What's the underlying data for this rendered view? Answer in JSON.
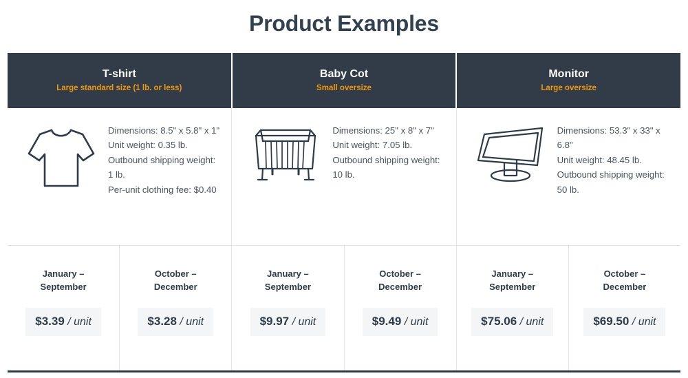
{
  "title": "Product Examples",
  "colors": {
    "header_bg": "#323c48",
    "header_accent": "#f0980c",
    "title_text": "#32414f",
    "body_text": "#4a5360",
    "price_pill_bg": "#f4f5f6",
    "border": "#e4e4e4",
    "bottom_rule": "#2e3b49"
  },
  "products": [
    {
      "name": "T-shirt",
      "size_class": "Large standard size (1 lb. or less)",
      "icon": "tshirt-icon",
      "specs": [
        "Dimensions: 8.5\" x 5.8\" x 1\"",
        "Unit weight: 0.35 lb.",
        "Outbound shipping weight: 1 lb.",
        "Per-unit clothing fee: $0.40"
      ],
      "pricing": [
        {
          "season": "January – September",
          "amount": "$3.39",
          "unit": "/ unit"
        },
        {
          "season": "October – December",
          "amount": "$3.28",
          "unit": "/ unit"
        }
      ]
    },
    {
      "name": "Baby Cot",
      "size_class": "Small oversize",
      "icon": "baby-cot-icon",
      "specs": [
        "Dimensions: 25\" x 8\" x 7\"",
        "Unit weight: 7.05 lb.",
        "Outbound shipping weight: 10 lb."
      ],
      "pricing": [
        {
          "season": "January – September",
          "amount": "$9.97",
          "unit": "/ unit"
        },
        {
          "season": "October – December",
          "amount": "$9.49",
          "unit": "/ unit"
        }
      ]
    },
    {
      "name": "Monitor",
      "size_class": "Large oversize",
      "icon": "monitor-icon",
      "specs": [
        "Dimensions: 53.3\" x 33\" x 6.8\"",
        "Unit weight: 48.45 lb.",
        "Outbound shipping weight: 50 lb."
      ],
      "pricing": [
        {
          "season": "January – September",
          "amount": "$75.06",
          "unit": "/ unit"
        },
        {
          "season": "October – December",
          "amount": "$69.50",
          "unit": "/ unit"
        }
      ]
    }
  ]
}
